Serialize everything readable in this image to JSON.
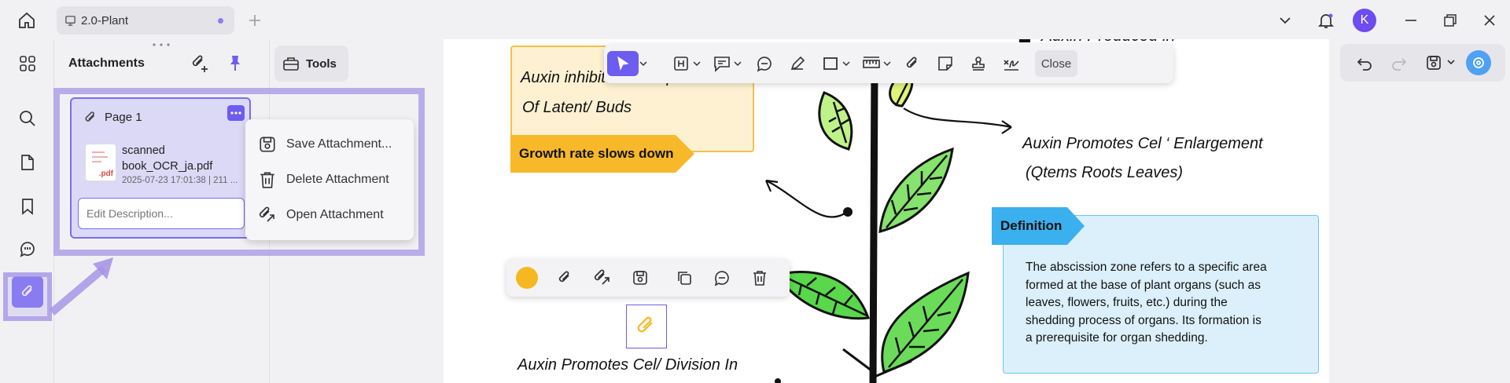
{
  "titlebar": {
    "tab_label": "2.0-Plant",
    "avatar_letter": "K"
  },
  "panel": {
    "title": "Attachments",
    "attachment": {
      "page_label": "Page 1",
      "file_name": "scanned book_OCR_ja.pdf",
      "file_name_line1": "scanned",
      "file_name_line2": "book_OCR_ja.pdf",
      "file_badge": ".pdf",
      "meta": "2025-07-23 17:01:38 | 211 ...",
      "description_placeholder": "Edit Description..."
    }
  },
  "context_menu": {
    "items": [
      {
        "label": "Save Attachment...",
        "icon": "save-icon"
      },
      {
        "label": "Delete Attachment",
        "icon": "trash-icon"
      },
      {
        "label": "Open Attachment",
        "icon": "open-attachment-icon"
      }
    ]
  },
  "tools": {
    "label": "Tools"
  },
  "toolbar": {
    "close_label": "Close"
  },
  "document": {
    "top_cut_text": "Auxin Produced in",
    "note1_line1": "Auxin inhibits Development",
    "note1_line2": "Of Latent/ Buds",
    "banner_growth": "Growth rate slows down",
    "right_text_line1": "Auxin Promotes Cel ‘ Enlargement",
    "right_text_line2": "(Qtems Roots Leaves)",
    "definition_label": "Definition",
    "definition_lines": [
      "The abscission zone refers to a specific area",
      "formed at the base of plant organs (such as",
      "leaves, flowers, fruits, etc.) during the",
      "shedding process of organs. Its formation is",
      "a prerequisite for organ shedding."
    ],
    "bottom_text": "Auxin Promotes Cel/ Division In"
  },
  "colors": {
    "accent": "#6d5cf0",
    "highlight": "#a696e6",
    "note_fill": "#fdf1d2",
    "note_border": "#f2c24c",
    "banner_orange": "#f7b82a",
    "definition_blue": "#3bb0ee",
    "definition_fill": "#dcf0fb",
    "leaf_green": "#7fe16a",
    "anno_color": "#f5b820"
  }
}
